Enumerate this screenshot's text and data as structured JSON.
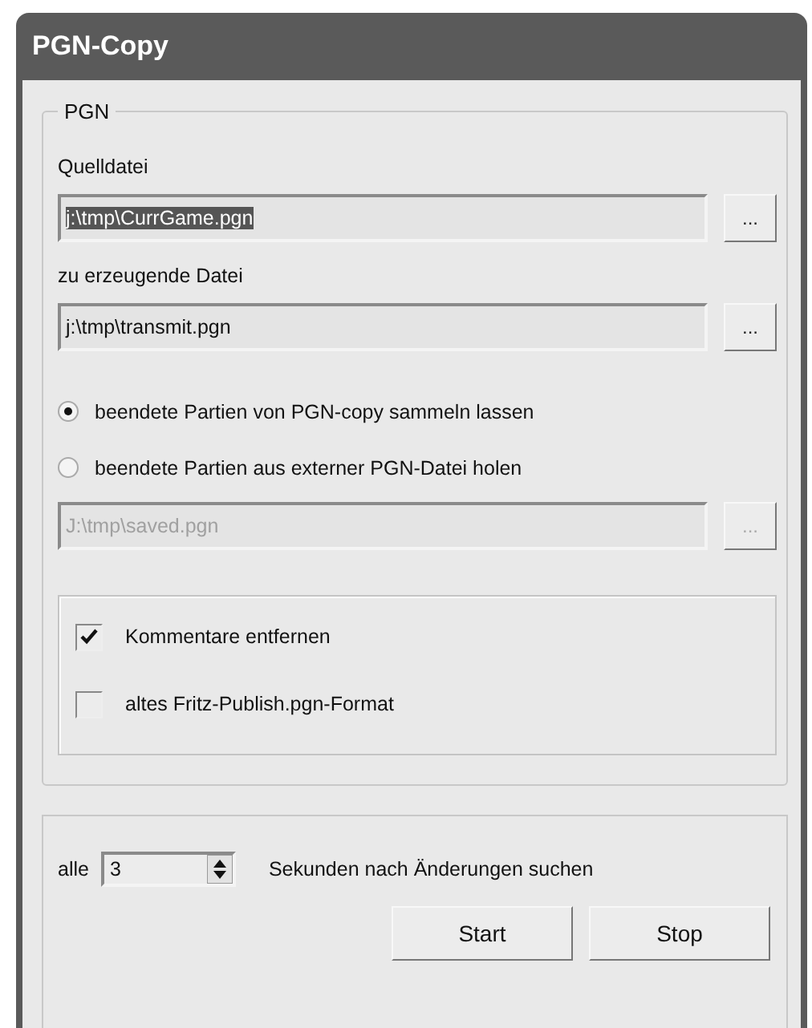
{
  "window": {
    "title": "PGN-Copy"
  },
  "group": {
    "legend": "PGN",
    "fields": [
      {
        "label": "Quelldatei",
        "value": "j:\\tmp\\CurrGame.pgn",
        "highlighted": true,
        "disabled": false,
        "button": "..."
      },
      {
        "label": "zu erzeugende Datei",
        "value": "j:\\tmp\\transmit.pgn",
        "highlighted": false,
        "disabled": false,
        "button": "..."
      }
    ],
    "radios": [
      {
        "label": "beendete Partien von PGN-copy sammeln lassen",
        "selected": true
      },
      {
        "label": "beendete Partien aus externer PGN-Datei holen",
        "selected": false
      }
    ],
    "external_field": {
      "value": "J:\\tmp\\saved.pgn",
      "highlighted": false,
      "disabled": true,
      "button": "..."
    },
    "checkboxes": [
      {
        "label": "Kommentare entfernen",
        "checked": true
      },
      {
        "label": "altes Fritz-Publish.pgn-Format",
        "checked": false
      }
    ]
  },
  "interval": {
    "prefix": "alle",
    "value": "3",
    "suffix": "Sekunden nach Änderungen suchen"
  },
  "buttons": [
    "Start",
    "Stop"
  ]
}
